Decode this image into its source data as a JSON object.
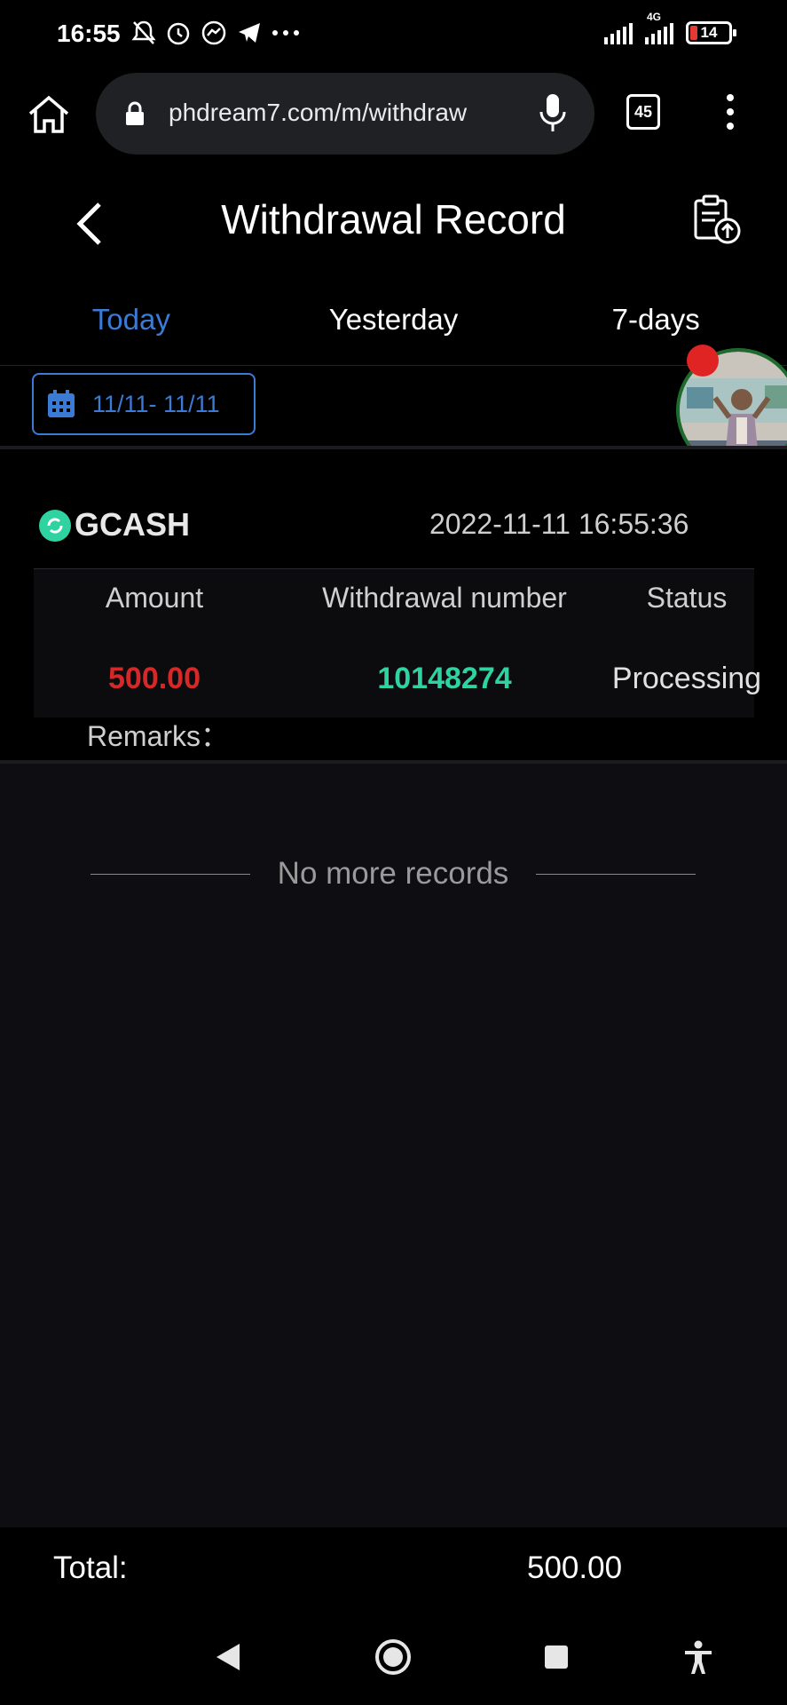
{
  "status_bar": {
    "time": "16:55",
    "icons": [
      "bell-off-icon",
      "alarm-icon",
      "messenger-icon",
      "telegram-icon",
      "more-dots-icon"
    ],
    "network": "4G",
    "battery": "14"
  },
  "browser": {
    "url": "phdream7.com/m/withdraw",
    "tab_count": "45"
  },
  "header": {
    "title": "Withdrawal Record"
  },
  "tabs": [
    {
      "label": "Today",
      "active": true
    },
    {
      "label": "Yesterday",
      "active": false
    },
    {
      "label": "7-days",
      "active": false
    }
  ],
  "filter": {
    "date_range": "11/11- 11/11"
  },
  "record": {
    "method": "GCASH",
    "time": "2022-11-11 16:55:36",
    "headers": {
      "amount": "Amount",
      "number": "Withdrawal number",
      "status": "Status"
    },
    "amount": "500.00",
    "number": "10148274",
    "status": "Processing",
    "remarks_label": "Remarks："
  },
  "list_end": "No more records",
  "footer": {
    "total_label": "Total:",
    "total_value": "500.00"
  },
  "colors": {
    "accent": "#3a7bd5",
    "amount": "#d62828",
    "number": "#2fd3a1",
    "background": "#0d0d12"
  }
}
